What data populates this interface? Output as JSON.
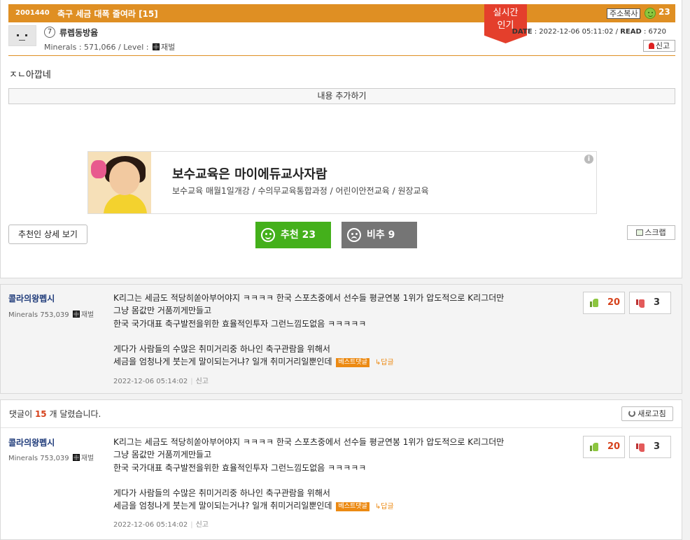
{
  "post": {
    "id": "2001440",
    "title": "축구 세금 대폭 줄여라 [15]",
    "copy_url_label": "주소복사",
    "likes": "23",
    "realtime_badge": "실시간\n인기",
    "author_level": "7",
    "author": "류렙동방윱",
    "minerals_label": "Minerals : 571,066 / Level :",
    "level_name": "재벌",
    "date_label": "DATE",
    "date": "2022-12-06 05:11:02",
    "read_label": "READ",
    "read": "6720",
    "report_label": "신고",
    "body": "ㅈㄴ아깝네",
    "add_content_label": "내용 추가하기"
  },
  "ad": {
    "title": "보수교육은 마이에듀교사자람",
    "description": "보수교육 매월1일개강 / 수의무교육통합과정 / 어린이안전교육 / 원장교육",
    "info_icon": "i"
  },
  "actions": {
    "recommenders_label": "추천인 상세 보기",
    "recommend_label": "추천 23",
    "oppose_label": "비추 9",
    "scrap_label": "스크랩"
  },
  "comments_header": {
    "prefix": "댓글이",
    "count": "15",
    "suffix": "개 달렸습니다.",
    "refresh_label": "새로고침"
  },
  "comments": [
    {
      "nick": "콜라의왕펩시",
      "minerals": "Minerals 753,039",
      "level": "재벌",
      "body": "K리그는 세금도 적당히쏟아부어야지 ㅋㅋㅋㅋ 한국 스포츠중에서 선수들 평균연봉 1위가 압도적으로 K리그더만\n그냥 몸값만 거품끼게만들고\n한국 국가대표 축구발전을위한 효율적인투자 그런느낌도없음 ㅋㅋㅋㅋㅋ\n\n게다가 사람들의 수많은 취미거리중 하나인 축구관람을 위해서\n세금을 엄청나게 붓는게 말이되는거냐?  일개 취미거리일뿐인데",
      "best_tag": "베스트댓글",
      "reply_label": "↳답글",
      "date": "2022-12-06 05:14:02",
      "report": "신고",
      "up": "20",
      "down": "3"
    },
    {
      "nick": "콜라의왕펩시",
      "minerals": "Minerals 753,039",
      "level": "재벌",
      "body": "K리그는 세금도 적당히쏟아부어야지 ㅋㅋㅋㅋ 한국 스포츠중에서 선수들 평균연봉 1위가 압도적으로 K리그더만\n그냥 몸값만 거품끼게만들고\n한국 국가대표 축구발전을위한 효율적인투자 그런느낌도없음 ㅋㅋㅋㅋㅋ\n\n게다가 사람들의 수많은 취미거리중 하나인 축구관람을 위해서\n세금을 엄청나게 붓는게 말이되는거냐?  일개 취미거리일뿐인데",
      "best_tag": "베스트댓글",
      "reply_label": "↳답글",
      "date": "2022-12-06 05:14:02",
      "report": "신고",
      "up": "20",
      "down": "3"
    }
  ],
  "colors": {
    "accent": "#df8f23",
    "recommend": "#44b01b",
    "oppose": "#757575",
    "badge": "#e43f2c"
  }
}
